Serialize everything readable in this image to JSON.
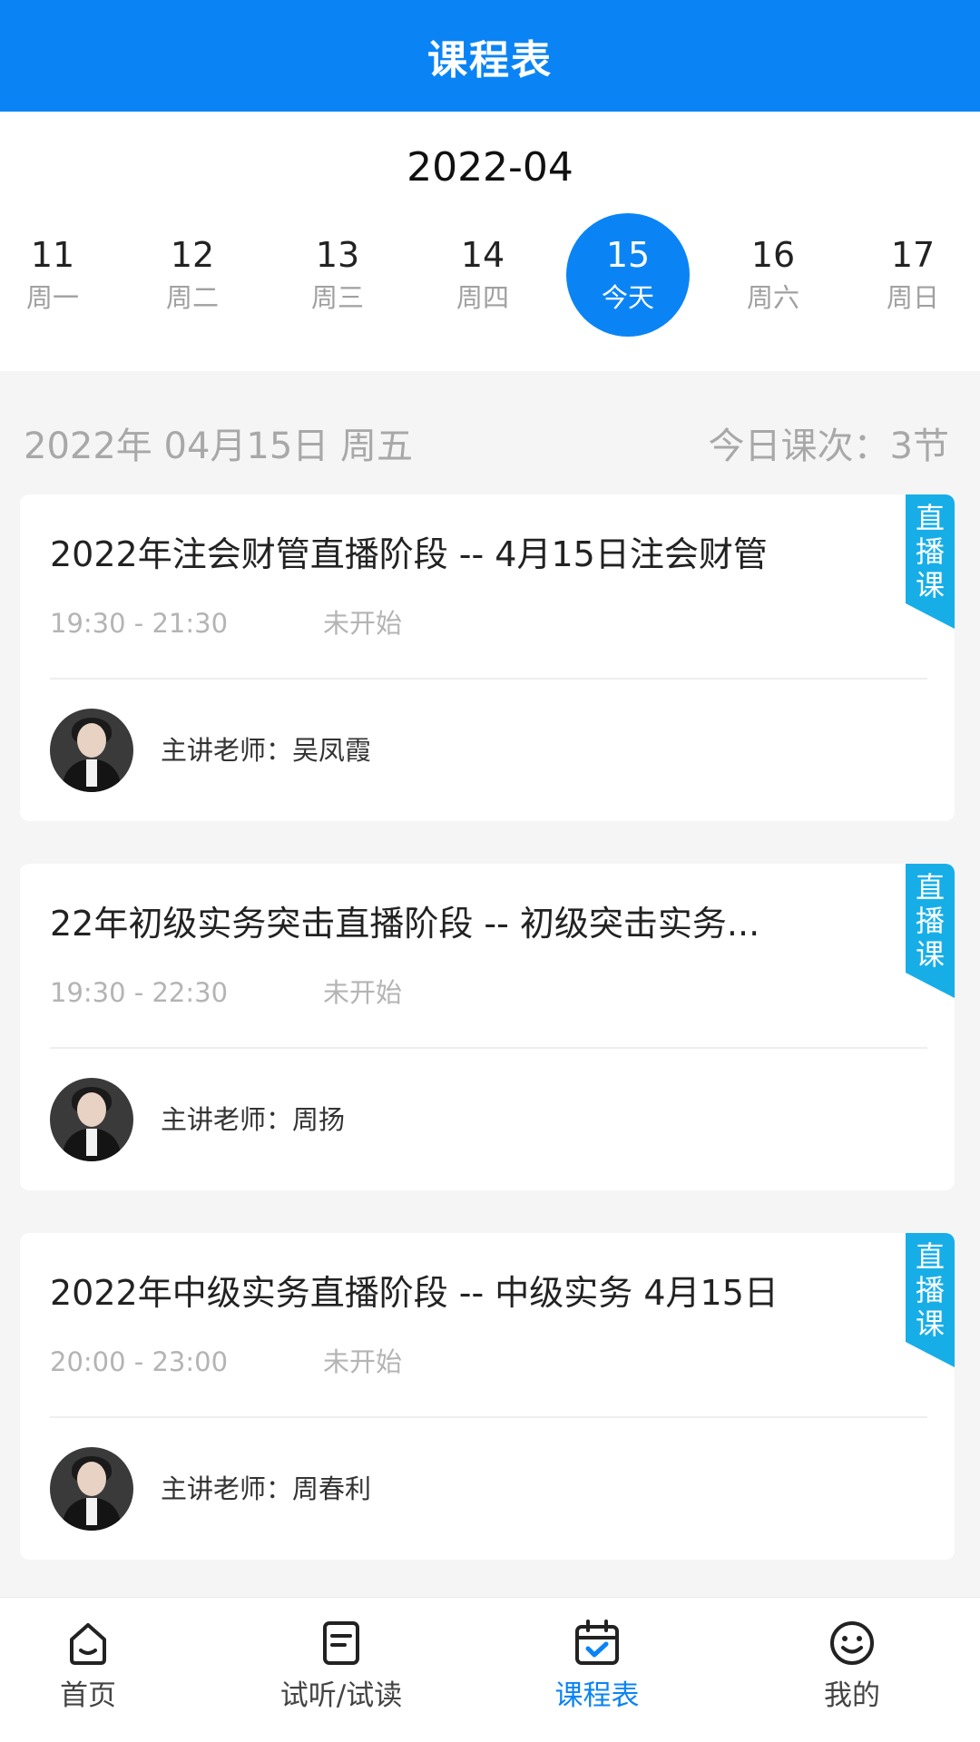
{
  "header": {
    "title": "课程表"
  },
  "calendar": {
    "month": "2022-04",
    "days": [
      {
        "num": "11",
        "label": "周一",
        "selected": false
      },
      {
        "num": "12",
        "label": "周二",
        "selected": false
      },
      {
        "num": "13",
        "label": "周三",
        "selected": false
      },
      {
        "num": "14",
        "label": "周四",
        "selected": false
      },
      {
        "num": "15",
        "label": "今天",
        "selected": true
      },
      {
        "num": "16",
        "label": "周六",
        "selected": false
      },
      {
        "num": "17",
        "label": "周日",
        "selected": false
      }
    ]
  },
  "summary": {
    "date": "2022年 04月15日  周五",
    "count": "今日课次：3节"
  },
  "courses": [
    {
      "title": "2022年注会财管直播阶段 -- 4月15日注会财管",
      "time": "19:30 - 21:30",
      "status": "未开始",
      "teacher": "主讲老师：吴凤霞",
      "badge": "直播课"
    },
    {
      "title": "22年初级实务突击直播阶段 -- 初级突击实务...",
      "time": "19:30 - 22:30",
      "status": "未开始",
      "teacher": "主讲老师：周扬",
      "badge": "直播课"
    },
    {
      "title": "2022年中级实务直播阶段 -- 中级实务 4月15日",
      "time": "20:00 - 23:00",
      "status": "未开始",
      "teacher": "主讲老师：周春利",
      "badge": "直播课"
    }
  ],
  "tabbar": {
    "tabs": [
      {
        "label": "首页",
        "icon": "home-icon",
        "active": false
      },
      {
        "label": "试听/试读",
        "icon": "document-icon",
        "active": false
      },
      {
        "label": "课程表",
        "icon": "calendar-icon",
        "active": true
      },
      {
        "label": "我的",
        "icon": "smiley-icon",
        "active": false
      }
    ]
  },
  "colors": {
    "accent": "#0a84f5",
    "badge": "#17aee8",
    "background": "#f5f5f5"
  }
}
